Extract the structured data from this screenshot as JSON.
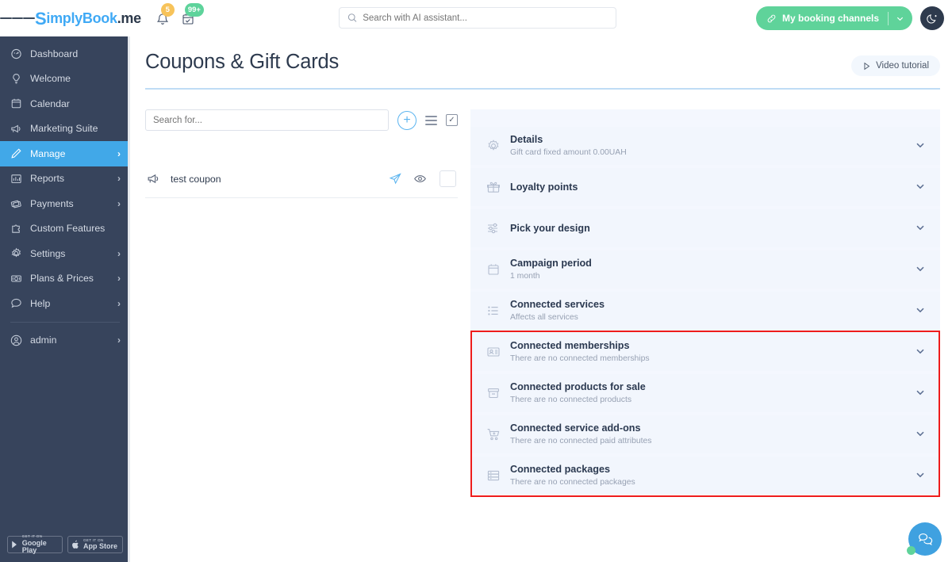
{
  "topbar": {
    "menu_icon": "hamburger-menu-icon",
    "logo_prefix": "S",
    "logo_main": "implyBook",
    "logo_suffix": ".me",
    "bell_icon": "bell-icon",
    "bell_badge": "5",
    "calendar_icon": "calendar-check-icon",
    "calendar_badge": "99+",
    "search": {
      "placeholder": "Search with AI assistant...",
      "value": "",
      "icon": "search-icon"
    },
    "booking_channels": {
      "label": "My booking channels",
      "icon": "link-icon",
      "chevron": "chevron-down-icon",
      "color": "#5fd39a"
    },
    "theme_toggle": {
      "icon": "moon-icon",
      "color": "#2e3a4d"
    }
  },
  "sidebar": {
    "background": "#37445c",
    "active_color": "#41a8e8",
    "items": [
      {
        "label": "Dashboard",
        "icon": "speedometer-icon",
        "chevron": false,
        "active": false
      },
      {
        "label": "Welcome",
        "icon": "lightbulb-icon",
        "chevron": false,
        "active": false
      },
      {
        "label": "Calendar",
        "icon": "calendar-icon",
        "chevron": false,
        "active": false
      },
      {
        "label": "Marketing Suite",
        "icon": "megaphone-icon",
        "chevron": false,
        "active": false
      },
      {
        "label": "Manage",
        "icon": "pencil-icon",
        "chevron": true,
        "active": true
      },
      {
        "label": "Reports",
        "icon": "bar-chart-icon",
        "chevron": true,
        "active": false
      },
      {
        "label": "Payments",
        "icon": "banknotes-icon",
        "chevron": true,
        "active": false
      },
      {
        "label": "Custom Features",
        "icon": "puzzle-icon",
        "chevron": false,
        "active": false
      },
      {
        "label": "Settings",
        "icon": "gear-icon",
        "chevron": true,
        "active": false
      },
      {
        "label": "Plans & Prices",
        "icon": "money-icon",
        "chevron": true,
        "active": false
      },
      {
        "label": "Help",
        "icon": "chat-bubble-icon",
        "chevron": true,
        "active": false
      }
    ],
    "account": {
      "label": "admin",
      "icon": "user-circle-icon",
      "chevron": true
    },
    "stores": [
      {
        "small": "GET IT ON",
        "big": "Google Play",
        "icon": "google-play-icon"
      },
      {
        "small": "GET IT ON",
        "big": "App Store",
        "icon": "apple-icon"
      }
    ]
  },
  "page": {
    "title": "Coupons & Gift Cards",
    "video_tutorial": {
      "label": "Video tutorial",
      "icon": "play-icon"
    }
  },
  "left_panel": {
    "search": {
      "placeholder": "Search for...",
      "value": ""
    },
    "add_button": {
      "label": "+",
      "icon": "plus-circle-icon"
    },
    "list_button": {
      "icon": "list-lines-icon"
    },
    "select_all_button": {
      "icon": "checkbox-checked-icon"
    },
    "coupons": [
      {
        "name": "test coupon",
        "icon": "megaphone-icon",
        "send_icon": "paper-plane-icon",
        "preview_icon": "eye-icon",
        "checkbox": ""
      }
    ]
  },
  "accordion": {
    "background": "#f2f6fd",
    "highlight_color": "#ee1c1c",
    "items": [
      {
        "title": "Details",
        "subtitle": "Gift card fixed amount 0.00UAH",
        "icon": "gear-icon",
        "chevron": "chevron-down-icon",
        "highlighted": false
      },
      {
        "title": "Loyalty points",
        "subtitle": "",
        "icon": "gift-icon",
        "chevron": "chevron-down-icon",
        "highlighted": false
      },
      {
        "title": "Pick your design",
        "subtitle": "",
        "icon": "sliders-icon",
        "chevron": "chevron-down-icon",
        "highlighted": false
      },
      {
        "title": "Campaign period",
        "subtitle": "1 month",
        "icon": "calendar-icon",
        "chevron": "chevron-down-icon",
        "highlighted": false
      },
      {
        "title": "Connected services",
        "subtitle": "Affects all services",
        "icon": "list-icon",
        "chevron": "chevron-down-icon",
        "highlighted": false
      },
      {
        "title": "Connected memberships",
        "subtitle": "There are no connected memberships",
        "icon": "id-card-icon",
        "chevron": "chevron-down-icon",
        "highlighted": true
      },
      {
        "title": "Connected products for sale",
        "subtitle": "There are no connected products",
        "icon": "box-icon",
        "chevron": "chevron-down-icon",
        "highlighted": true
      },
      {
        "title": "Connected service add-ons",
        "subtitle": "There are no connected paid attributes",
        "icon": "cart-plus-icon",
        "chevron": "chevron-down-icon",
        "highlighted": true
      },
      {
        "title": "Connected packages",
        "subtitle": "There are no connected packages",
        "icon": "stacked-box-icon",
        "chevron": "chevron-down-icon",
        "highlighted": true
      }
    ]
  },
  "chat_widget": {
    "icon": "chat-bubbles-icon",
    "color": "#3fa1e0",
    "status_color": "#5fd39a"
  }
}
